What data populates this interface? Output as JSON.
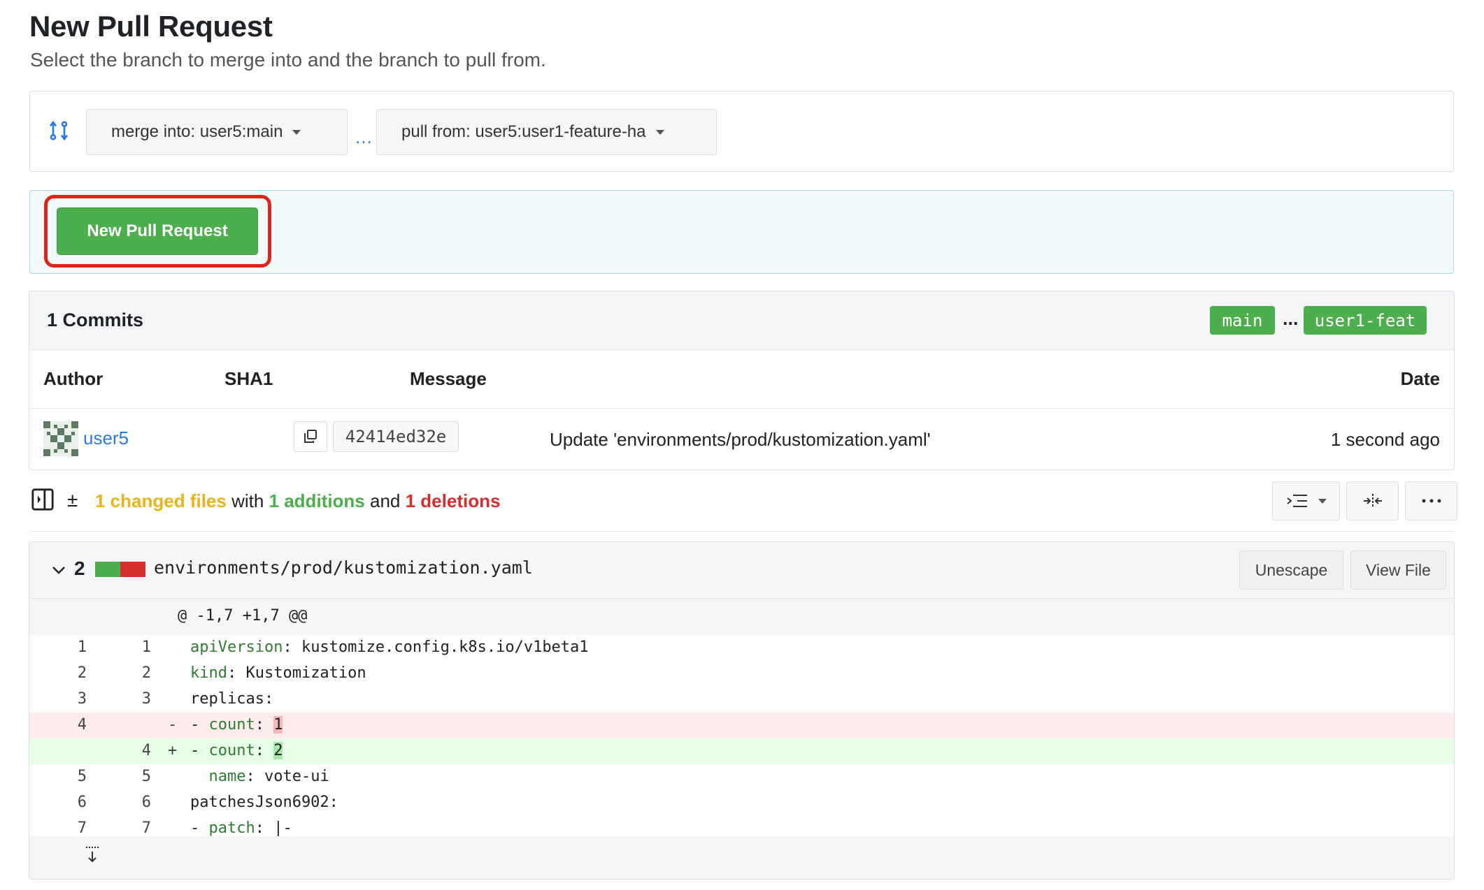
{
  "header": {
    "title": "New Pull Request",
    "subtitle": "Select the branch to merge into and the branch to pull from."
  },
  "branches": {
    "merge_into": "merge into: user5:main",
    "separator": "...",
    "pull_from": "pull from: user5:user1-feature-ha"
  },
  "action": {
    "button_label": "New Pull Request"
  },
  "commits": {
    "title": "1 Commits",
    "base_tag": "main",
    "tag_separator": "...",
    "head_tag": "user1-feat",
    "columns": [
      "Author",
      "SHA1",
      "Message",
      "Date"
    ],
    "rows": [
      {
        "author": "user5",
        "sha": "42414ed32e",
        "message": "Update 'environments/prod/kustomization.yaml'",
        "date": "1 second ago"
      }
    ]
  },
  "stats": {
    "pm": "±",
    "changed": "1 changed files",
    "with": " with ",
    "additions": "1 additions",
    "and": " and ",
    "deletions": "1 deletions"
  },
  "file": {
    "count": "2",
    "name": "environments/prod/kustomization.yaml",
    "unescape_label": "Unescape",
    "view_file_label": "View File",
    "hunk": "@ -1,7 +1,7 @@",
    "lines": [
      {
        "old": "1",
        "new": "1",
        "sign": "",
        "key": "apiVersion",
        "rest": ": kustomize.config.k8s.io/v1beta1"
      },
      {
        "old": "2",
        "new": "2",
        "sign": "",
        "key": "kind",
        "rest": ": Kustomization"
      },
      {
        "old": "3",
        "new": "3",
        "sign": "",
        "plain": "replicas:"
      },
      {
        "old": "4",
        "new": "",
        "sign": "-",
        "prefix": "- ",
        "key": "count",
        "sep": ": ",
        "val": "1"
      },
      {
        "old": "",
        "new": "4",
        "sign": "+",
        "prefix": "- ",
        "key": "count",
        "sep": ": ",
        "val": "2"
      },
      {
        "old": "5",
        "new": "5",
        "sign": "",
        "prefix": "  ",
        "key": "name",
        "rest": ": vote-ui"
      },
      {
        "old": "6",
        "new": "6",
        "sign": "",
        "plain": "patchesJson6902:"
      },
      {
        "old": "7",
        "new": "7",
        "sign": "",
        "prefix": "- ",
        "key": "patch",
        "rest": ": |-"
      }
    ]
  },
  "colors": {
    "accent_green": "#4cae4c",
    "deletion_red": "#d62d2d",
    "link_blue": "#2a7ae2",
    "highlight_frame": "#e2231a",
    "changed_yellow": "#e8b31b"
  },
  "icons": [
    "compare-arrows-icon",
    "caret-down-icon",
    "avatar-identicon",
    "copy-icon",
    "sidebar-toggle-icon",
    "indent-list-icon",
    "split-view-icon",
    "ellipsis-icon",
    "chevron-down-icon",
    "expand-down-icon"
  ]
}
